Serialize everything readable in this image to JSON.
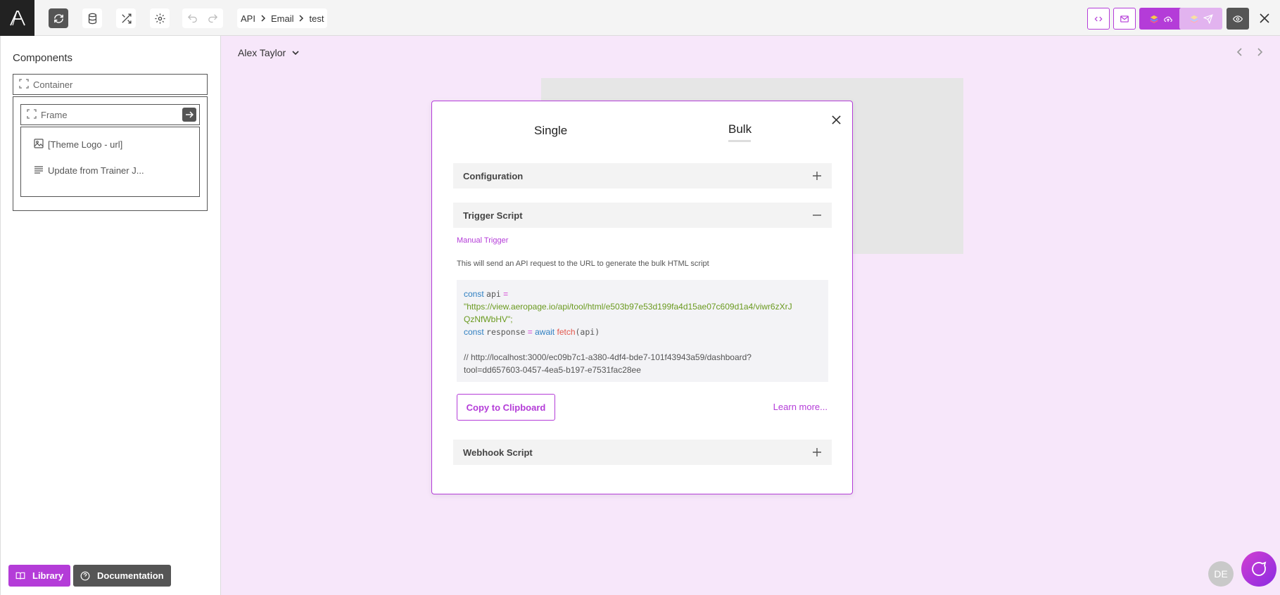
{
  "breadcrumb": [
    "API",
    "Email",
    "test"
  ],
  "sidebar": {
    "title": "Components",
    "container_label": "Container",
    "frame_label": "Frame",
    "items": [
      {
        "label": "[Theme Logo - url]",
        "icon": "image-icon"
      },
      {
        "label": "Update from Trainer J...",
        "icon": "text-lines-icon"
      }
    ],
    "library_label": "Library",
    "documentation_label": "Documentation"
  },
  "main": {
    "user_name": "Alex Taylor",
    "avatar_initials": "DE"
  },
  "modal": {
    "tab_single": "Single",
    "tab_bulk": "Bulk",
    "configuration_label": "Configuration",
    "trigger_script_label": "Trigger Script",
    "manual_trigger": "Manual Trigger",
    "description": "This will send an API request to the URL to generate the bulk HTML script",
    "code": {
      "line1_kw": "const",
      "line1_var": "api",
      "line1_op": "=",
      "url_part1": "\"https://view.aeropage.io/api/tool/html/e503b97e53d199fa4d15ae07c609d1a4/viwr6zXrJ",
      "url_part2": "QzNfWbHV\";",
      "line3_kw": "const",
      "line3_var": "response",
      "line3_op": "=",
      "line3_await": "await",
      "line3_fn": "fetch",
      "line3_arg": "(api)",
      "comment1": "// http://localhost:3000/ec09b7c1-a380-4df4-bde7-101f43943a59/dashboard?",
      "comment2": "tool=dd657603-0457-4ea5-b197-e7531fac28ee"
    },
    "copy_label": "Copy to Clipboard",
    "learn_more": "Learn more...",
    "webhook_label": "Webhook Script"
  },
  "colors": {
    "accent": "#b43cd8",
    "canvas_bg": "#f7e7fa",
    "dark_button": "#555555"
  }
}
